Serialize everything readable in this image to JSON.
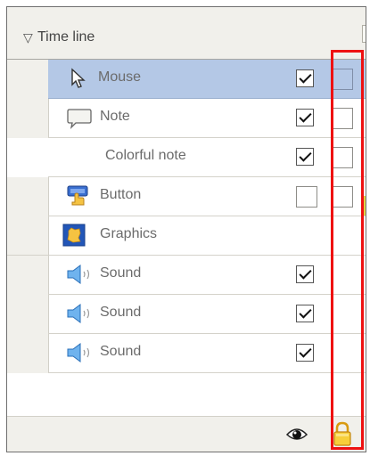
{
  "timeline": {
    "title": "Time line",
    "rows": [
      {
        "label": "Mouse",
        "visible": true,
        "locked": false,
        "selected": true,
        "icon": "cursor-icon"
      },
      {
        "label": "Note",
        "visible": true,
        "locked": false,
        "selected": false,
        "icon": "note-icon"
      },
      {
        "label": "Colorful note",
        "visible": true,
        "locked": false,
        "selected": false,
        "icon": ""
      },
      {
        "label": "Button",
        "visible": false,
        "locked": false,
        "selected": false,
        "icon": "button-icon"
      },
      {
        "label": "Graphics",
        "visible": null,
        "locked": null,
        "selected": false,
        "icon": "graphics-icon"
      },
      {
        "label": "Sound",
        "visible": true,
        "locked": null,
        "selected": false,
        "icon": "sound-icon"
      },
      {
        "label": "Sound",
        "visible": true,
        "locked": null,
        "selected": false,
        "icon": "sound-icon"
      },
      {
        "label": "Sound",
        "visible": true,
        "locked": null,
        "selected": false,
        "icon": "sound-icon"
      }
    ],
    "footer": {
      "eye_icon": "eye-icon",
      "lock_icon": "lock-icon"
    }
  },
  "colors": {
    "selection": "#b4c8e6",
    "panel": "#f1f0eb",
    "highlight_border": "#ee1111",
    "lock": "#f2c21b"
  }
}
